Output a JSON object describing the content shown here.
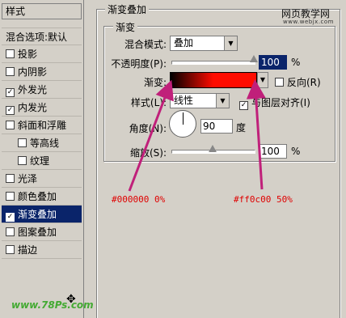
{
  "style_list": {
    "header": "样式",
    "blend_options": "混合选项:默认",
    "items": [
      {
        "label": "投影",
        "checked": false,
        "sub": false,
        "active": false
      },
      {
        "label": "内阴影",
        "checked": false,
        "sub": false,
        "active": false
      },
      {
        "label": "外发光",
        "checked": true,
        "sub": false,
        "active": false
      },
      {
        "label": "内发光",
        "checked": true,
        "sub": false,
        "active": false
      },
      {
        "label": "斜面和浮雕",
        "checked": false,
        "sub": false,
        "active": false
      },
      {
        "label": "等高线",
        "checked": false,
        "sub": true,
        "active": false
      },
      {
        "label": "纹理",
        "checked": false,
        "sub": true,
        "active": false
      },
      {
        "label": "光泽",
        "checked": false,
        "sub": false,
        "active": false
      },
      {
        "label": "颜色叠加",
        "checked": false,
        "sub": false,
        "active": false
      },
      {
        "label": "渐变叠加",
        "checked": true,
        "sub": false,
        "active": true
      },
      {
        "label": "图案叠加",
        "checked": false,
        "sub": false,
        "active": false
      },
      {
        "label": "描边",
        "checked": false,
        "sub": false,
        "active": false
      }
    ],
    "footer_logo": "www.78Ps.com"
  },
  "outer_group": {
    "title": "渐变叠加"
  },
  "inner_group": {
    "title": "渐变"
  },
  "blend_mode": {
    "label": "混合模式:",
    "value": "叠加"
  },
  "opacity": {
    "label": "不透明度(P):",
    "value": "100",
    "unit": "%",
    "level": 1.0
  },
  "gradient": {
    "label": "渐变:",
    "start_color": "#000000",
    "end_color": "#ff0c00",
    "reverse_label": "反向(R)",
    "reverse_checked": false
  },
  "style": {
    "label": "样式(L):",
    "value": "线性",
    "align_label": "与图层对齐(I)",
    "align_checked": true
  },
  "angle": {
    "label": "角度(N):",
    "value": "90",
    "unit": "度"
  },
  "scale": {
    "label": "缩放(S):",
    "value": "100",
    "unit": "%",
    "level": 0.5
  },
  "annotations": {
    "left": "#000000 0%",
    "right": "#ff0c00 50%"
  },
  "watermark": {
    "line1": "网页教学网",
    "line2": "www.webjx.com"
  },
  "colors": {
    "arrow": "#c0207a",
    "selection": "#0a246a",
    "annotation_text": "#e00000"
  }
}
